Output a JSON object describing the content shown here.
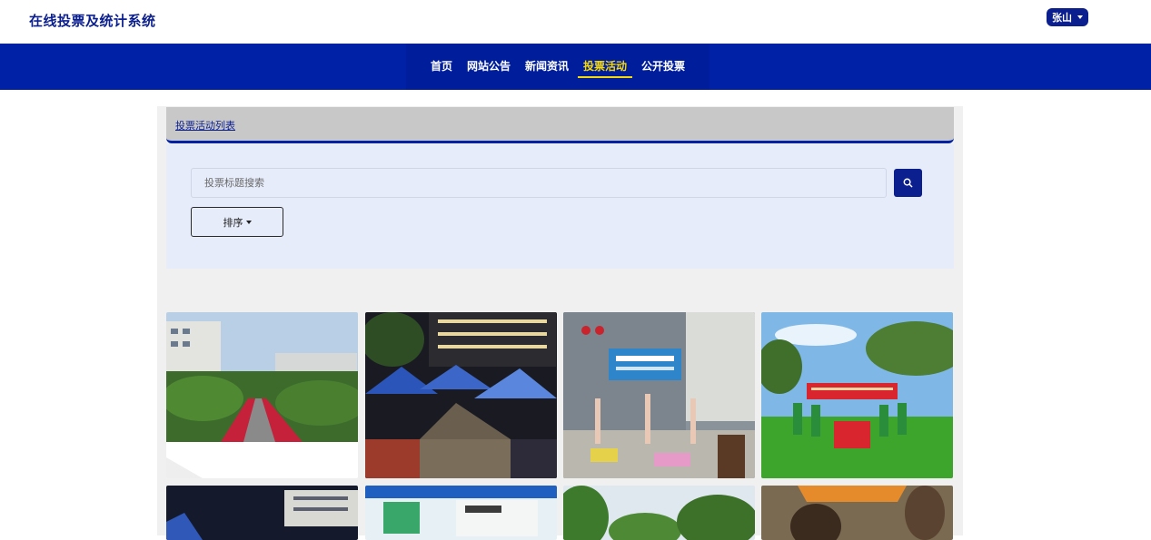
{
  "header": {
    "site_title": "在线投票及统计系统",
    "user_name": "张山"
  },
  "nav": {
    "items": [
      {
        "label": "首页",
        "active": false
      },
      {
        "label": "网站公告",
        "active": false
      },
      {
        "label": "新闻资讯",
        "active": false
      },
      {
        "label": "投票活动",
        "active": true
      },
      {
        "label": "公开投票",
        "active": false
      }
    ]
  },
  "breadcrumb": {
    "label": "投票活动列表"
  },
  "search": {
    "placeholder": "投票标题搜索",
    "value": ""
  },
  "sort": {
    "label": "排序"
  },
  "colors": {
    "brand": "#0b1f8f",
    "nav_bg": "#0021a5",
    "active": "#f5d90a"
  },
  "activities": [
    {
      "scene": "campus-market"
    },
    {
      "scene": "night-tents"
    },
    {
      "scene": "yoga-event"
    },
    {
      "scene": "team-banner"
    },
    {
      "scene": "night-building"
    },
    {
      "scene": "blue-tent"
    },
    {
      "scene": "green-hills"
    },
    {
      "scene": "orange-tent"
    }
  ]
}
